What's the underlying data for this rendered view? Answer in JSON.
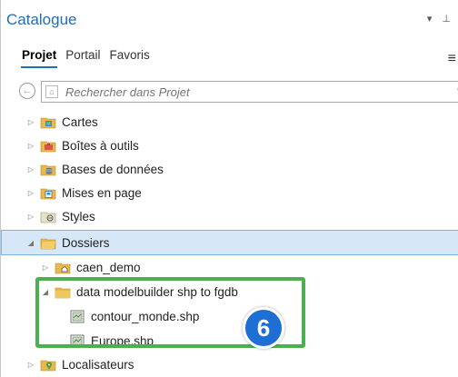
{
  "window": {
    "title": "Catalogue",
    "controls": "▾ ⊥"
  },
  "tabs": [
    {
      "label": "Projet",
      "active": true
    },
    {
      "label": "Portail",
      "active": false
    },
    {
      "label": "Favoris",
      "active": false
    }
  ],
  "search": {
    "placeholder": "Rechercher dans Projet"
  },
  "tree": [
    {
      "label": "Cartes",
      "icon": "maps-folder-icon",
      "expanded": false
    },
    {
      "label": "Boîtes à outils",
      "icon": "toolbox-folder-icon",
      "expanded": false
    },
    {
      "label": "Bases de données",
      "icon": "database-folder-icon",
      "expanded": false
    },
    {
      "label": "Mises en page",
      "icon": "layouts-folder-icon",
      "expanded": false
    },
    {
      "label": "Styles",
      "icon": "styles-folder-icon",
      "expanded": false
    },
    {
      "label": "Dossiers",
      "icon": "folders-icon",
      "expanded": true,
      "selected": true
    },
    {
      "label": "caen_demo",
      "icon": "home-folder-icon",
      "expanded": false
    },
    {
      "label": "data modelbuilder shp to fgdb",
      "icon": "folder-icon",
      "expanded": true
    },
    {
      "label": "contour_monde.shp",
      "icon": "shapefile-icon"
    },
    {
      "label": "Europe.shp",
      "icon": "shapefile-icon"
    },
    {
      "label": "Localisateurs",
      "icon": "locators-folder-icon",
      "expanded": false
    }
  ],
  "callout": {
    "number": "6"
  },
  "colors": {
    "accent": "#1f6fb8",
    "folder": "#e8b84a",
    "highlight": "#4caf50",
    "badge": "#1e6fd4"
  }
}
